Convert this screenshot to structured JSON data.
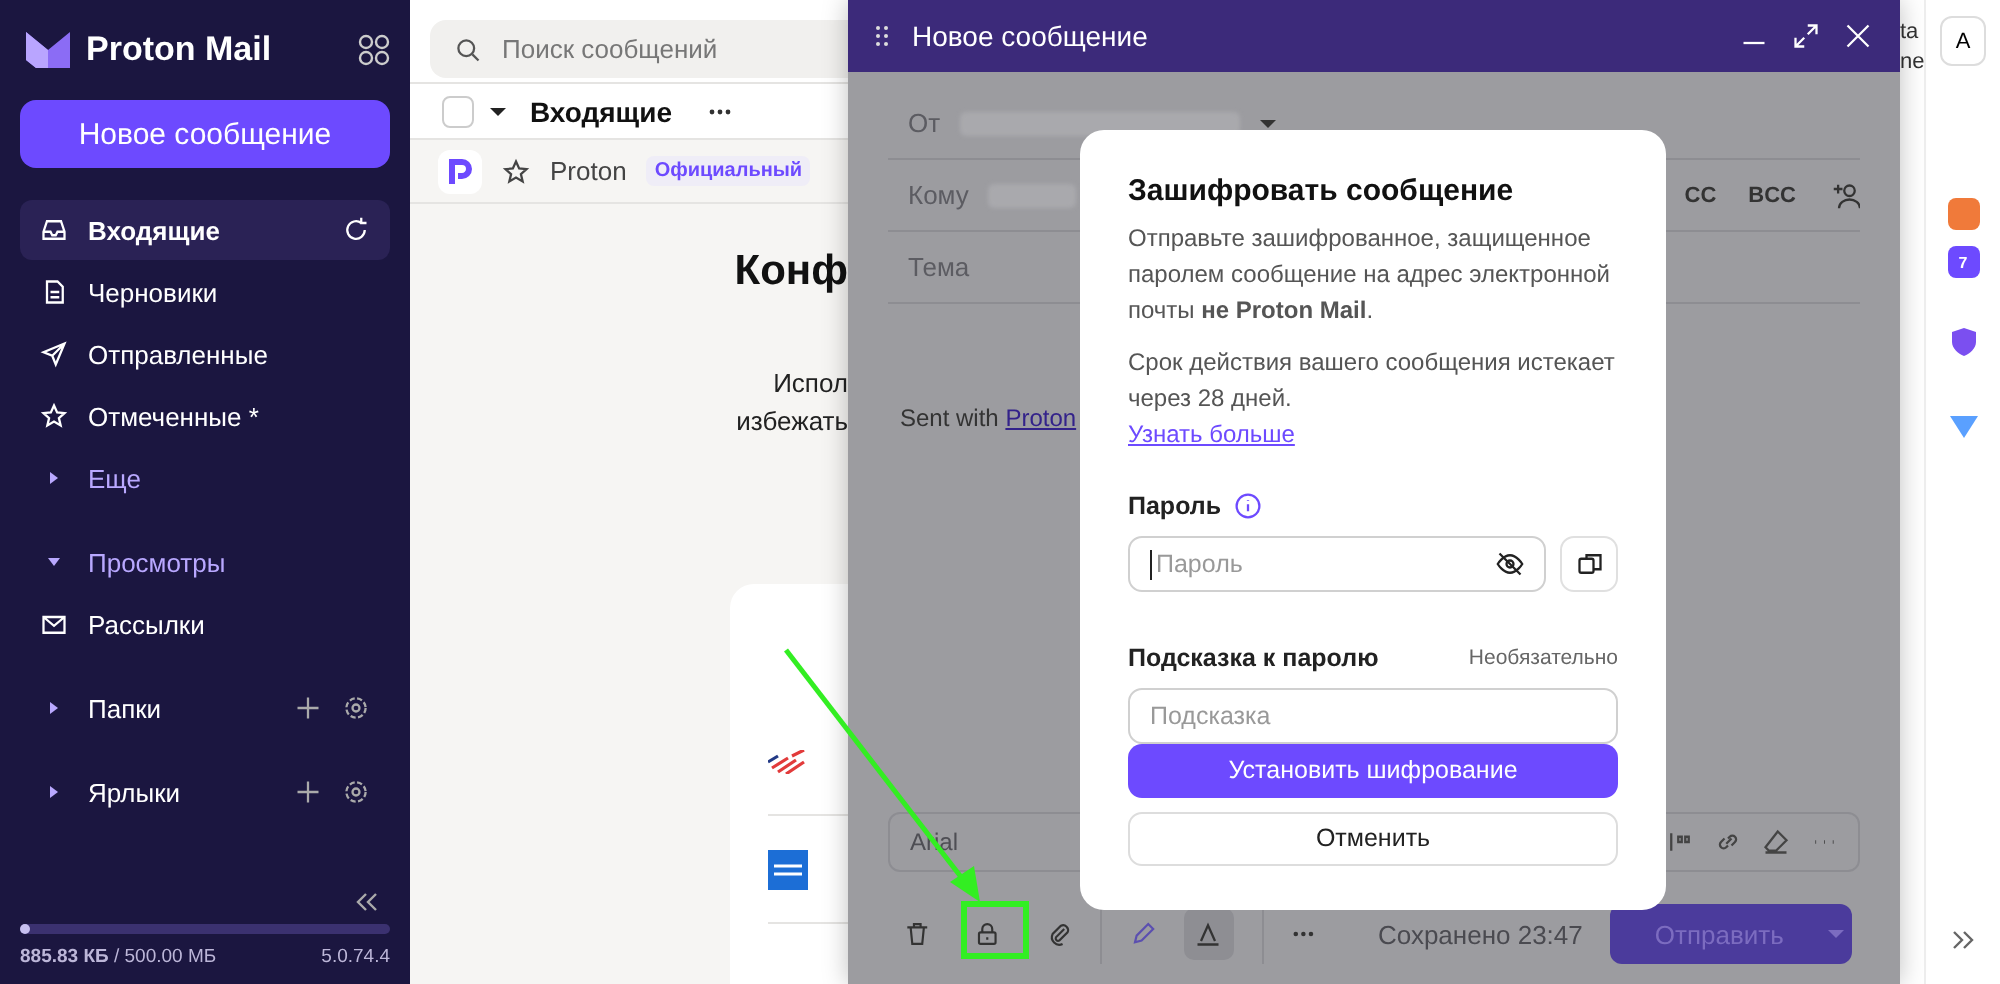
{
  "sidebar": {
    "brand": "Proton Mail",
    "compose_button": "Новое сообщение",
    "items": [
      {
        "kind": "inbox",
        "label": "Входящие",
        "selected": true
      },
      {
        "kind": "drafts",
        "label": "Черновики",
        "selected": false
      },
      {
        "kind": "sent",
        "label": "Отправленные",
        "selected": false
      },
      {
        "kind": "starred",
        "label": "Отмеченные *",
        "selected": false
      },
      {
        "kind": "group",
        "label": "Еще",
        "expanded": false
      },
      {
        "kind": "group",
        "label": "Просмотры",
        "expanded": true
      },
      {
        "kind": "newsletters",
        "label": "Рассылки",
        "selected": false
      },
      {
        "kind": "section",
        "label": "Папки",
        "expanded": false
      },
      {
        "kind": "section",
        "label": "Ярлыки",
        "expanded": false
      }
    ],
    "storage": {
      "text": "**885.83 КБ** / 500.00 МБ",
      "level": 0.02
    },
    "version": "5.0.74.4"
  },
  "message_list": {
    "select_all_checked": false,
    "search_placeholder": "Поиск сообщений",
    "folder_title": "Входящие",
    "sender": "Proton",
    "sender_badge": "Официальный",
    "starred": false,
    "heading": "Конф",
    "body_lines": [
      "Испол",
      "избежать"
    ]
  },
  "header_fragments": [
    "ta",
    "ne"
  ],
  "composer": {
    "title": "Новое сообщение",
    "from_label": "От",
    "to_label": "Кому",
    "subject_label": "Тема",
    "cc": "CC",
    "bcc": "BCC",
    "body_prefix": "Sent with",
    "body_link": "Proton",
    "font": "Arial",
    "saved": "Сохранено 23:47",
    "send": "Отправить",
    "encrypt_highlighted": true
  },
  "dialog": {
    "title": "Зашифровать сообщение",
    "description": "Отправьте зашифрованное, защищенное паролем сообщение на адрес электронной почты **не Proton Mail**.",
    "expiry": "Срок действия вашего сообщения истекает через 28 дней.",
    "learn_more": "Узнать больше",
    "password_label": "Пароль",
    "password_placeholder": "Пароль",
    "hint_label": "Подсказка к паролю",
    "hint_optional": "Необязательно",
    "hint_placeholder": "Подсказка",
    "primary_button": "Установить шифрование",
    "secondary_button": "Отменить"
  },
  "rail": {
    "avatar": "A",
    "apps": [
      {
        "kind": "contacts"
      },
      {
        "kind": "calendar",
        "label": "7"
      },
      {
        "kind": "vpn"
      },
      {
        "kind": "drive"
      }
    ]
  }
}
